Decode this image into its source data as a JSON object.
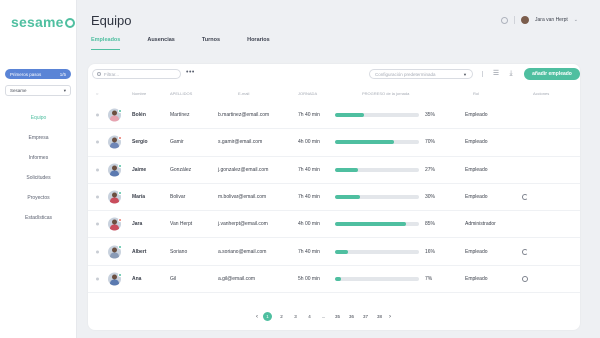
{
  "app": {
    "logo_text": "sesame"
  },
  "sidebar": {
    "first_steps": {
      "label": "Primeros pasos",
      "progress": "1/5"
    },
    "company": {
      "selected": "Sesame"
    },
    "items": [
      {
        "label": "Equipo",
        "active": true
      },
      {
        "label": "Empresa",
        "active": false
      },
      {
        "label": "Informes",
        "active": false
      },
      {
        "label": "Solicitudes",
        "active": false
      },
      {
        "label": "Proyectos",
        "active": false
      },
      {
        "label": "Estadísticas",
        "active": false
      }
    ]
  },
  "header": {
    "title": "Equipo",
    "tabs": [
      {
        "label": "Empleados",
        "active": true
      },
      {
        "label": "Ausencias",
        "active": false
      },
      {
        "label": "Turnos",
        "active": false
      },
      {
        "label": "Horarios",
        "active": false
      }
    ],
    "user": {
      "name": "Jara van Herpt"
    }
  },
  "toolbar": {
    "filter_placeholder": "Filtrar...",
    "more_label": "•••",
    "config_placeholder": "Configuración predeterminada",
    "add_label": "añadir empleado"
  },
  "table": {
    "columns": {
      "first_name": "Nombre",
      "last_name": "APELLIDOS",
      "email": "E-mail",
      "hours": "JORNADA",
      "progress": "PROGRESO de la jornada",
      "role": "Rol",
      "actions": "Acciones"
    },
    "rows": [
      {
        "first_name": "Bolén",
        "last_name": "Martínez",
        "email": "b.martinez@email.com",
        "hours": "7h 40 min",
        "progress": 35,
        "progress_label": "35%",
        "role": "Empleado",
        "status": "#4fbfa0",
        "shirt": "#e7a3b0",
        "action_icon": ""
      },
      {
        "first_name": "Sergio",
        "last_name": "Gamir",
        "email": "s.gamir@email.com",
        "hours": "4h 00 min",
        "progress": 70,
        "progress_label": "70%",
        "role": "Empleado",
        "status": "#e9776b",
        "shirt": "#6f86b7",
        "action_icon": ""
      },
      {
        "first_name": "Jaime",
        "last_name": "González",
        "email": "j.gonzalez@email.com",
        "hours": "7h 40 min",
        "progress": 27,
        "progress_label": "27%",
        "role": "Empleado",
        "status": "#4fbfa0",
        "shirt": "#5b7ab0",
        "action_icon": ""
      },
      {
        "first_name": "María",
        "last_name": "Bolivar",
        "email": "m.bolivar@email.com",
        "hours": "7h 40 min",
        "progress": 30,
        "progress_label": "30%",
        "role": "Empleado",
        "status": "#4fbfa0",
        "shirt": "#c94d5c",
        "action_icon": "refresh-icon"
      },
      {
        "first_name": "Jara",
        "last_name": "Van Herpt",
        "email": "j.vanherpt@email.com",
        "hours": "4h 00 min",
        "progress": 85,
        "progress_label": "85%",
        "role": "Administrador",
        "status": "#e9776b",
        "shirt": "#c94d5c",
        "action_icon": ""
      },
      {
        "first_name": "Albert",
        "last_name": "Soriano",
        "email": "a.soriano@email.com",
        "hours": "7h 40 min",
        "progress": 16,
        "progress_label": "16%",
        "role": "Empleado",
        "status": "#4fbfa0",
        "shirt": "#8a9bb6",
        "action_icon": "refresh-icon"
      },
      {
        "first_name": "Ana",
        "last_name": "Gil",
        "email": "a.gil@email.com",
        "hours": "5h 00 min",
        "progress": 7,
        "progress_label": "7%",
        "role": "Empleado",
        "status": "#4fbfa0",
        "shirt": "#5b7ab0",
        "action_icon": "clock-icon"
      }
    ]
  },
  "pagination": {
    "prev": "‹",
    "next": "›",
    "pages": [
      "1",
      "2",
      "3",
      "4",
      "...",
      "35",
      "36",
      "37",
      "38"
    ],
    "active": "1"
  },
  "colors": {
    "accent": "#4fbfa0",
    "primary_blue": "#5a84d6"
  }
}
